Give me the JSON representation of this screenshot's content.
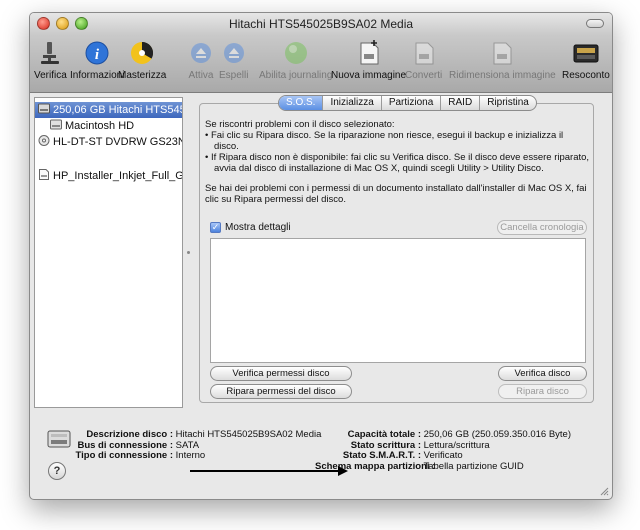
{
  "window": {
    "title": "Hitachi HTS545025B9SA02 Media"
  },
  "toolbar": {
    "items": [
      {
        "label": "Verifica",
        "icon": "microscope-icon",
        "enabled": true
      },
      {
        "label": "Informazioni",
        "icon": "info-icon",
        "enabled": true
      },
      {
        "label": "Masterizza",
        "icon": "burn-icon",
        "enabled": true
      },
      {
        "label": "Attiva",
        "icon": "eject-icon",
        "enabled": false
      },
      {
        "label": "Espelli",
        "icon": "eject-icon",
        "enabled": false
      },
      {
        "label": "Abilita journaling",
        "icon": "journaling-icon",
        "enabled": false
      },
      {
        "label": "Nuova immagine",
        "icon": "new-image-icon",
        "enabled": true
      },
      {
        "label": "Converti",
        "icon": "convert-icon",
        "enabled": false
      },
      {
        "label": "Ridimensiona immagine",
        "icon": "resize-image-icon",
        "enabled": false
      },
      {
        "label": "Resoconto",
        "icon": "log-icon",
        "enabled": true
      }
    ]
  },
  "sidebar": {
    "items": [
      {
        "label": "250,06 GB Hitachi HTS545...",
        "icon": "hard-disk-icon",
        "selected": true
      },
      {
        "label": "Macintosh HD",
        "icon": "volume-icon",
        "selected": false
      },
      {
        "label": "HL-DT-ST DVDRW GS23N",
        "icon": "optical-drive-icon",
        "selected": false
      },
      {
        "label": "HP_Installer_Inkjet_Full_Gr...",
        "icon": "disk-image-icon",
        "selected": false
      }
    ]
  },
  "tabs": [
    "S.O.S.",
    "Inizializza",
    "Partiziona",
    "RAID",
    "Ripristina"
  ],
  "sos": {
    "intro": "Se riscontri problemi con il disco selezionato:",
    "bullet1": "• Fai clic su Ripara disco. Se la riparazione non riesce, esegui il backup e inizializza il disco.",
    "bullet2": "• If Ripara disco non è disponibile: fai clic su Verifica disco. Se il disco deve essere riparato, avvia dal disco di installazione di Mac OS X, quindi scegli Utility > Utility Disco.",
    "note": "Se hai dei problemi con i permessi di un documento installato dall'installer di Mac OS X, fai clic su Ripara permessi del disco.",
    "show_details": "Mostra dettagli",
    "clear_history": "Cancella cronologia",
    "verify_permissions": "Verifica permessi disco",
    "repair_permissions": "Ripara permessi del disco",
    "verify_disk": "Verifica disco",
    "repair_disk": "Ripara disco"
  },
  "info": {
    "left": [
      {
        "label": "Descrizione disco :",
        "value": "Hitachi HTS545025B9SA02 Media"
      },
      {
        "label": "Bus di connessione :",
        "value": "SATA"
      },
      {
        "label": "Tipo di connessione :",
        "value": "Interno"
      }
    ],
    "right": [
      {
        "label": "Capacità totale :",
        "value": "250,06 GB (250.059.350.016 Byte)"
      },
      {
        "label": "Stato scrittura :",
        "value": "Lettura/scrittura"
      },
      {
        "label": "Stato S.M.A.R.T. :",
        "value": "Verificato"
      },
      {
        "label": "Schema mappa partizioni :",
        "value": "Tabella partizione GUID"
      }
    ]
  },
  "help": "?"
}
